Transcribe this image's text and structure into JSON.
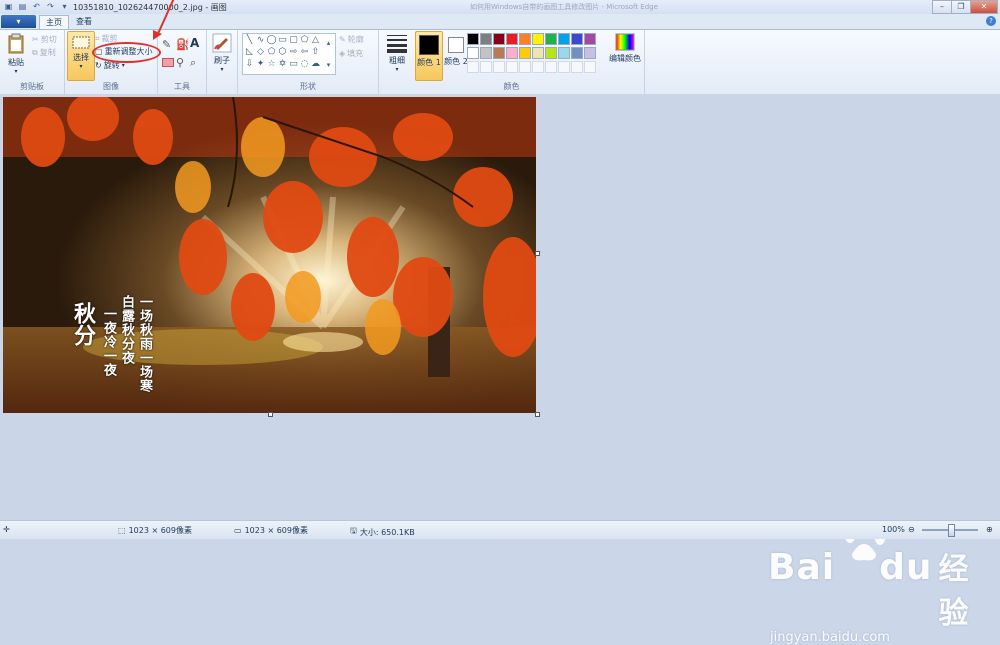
{
  "window": {
    "title": "10351810_102624470000_2.jpg - 画图",
    "faded_title": "如何用Windows自带的画图工具修改图片 - Microsoft Edge"
  },
  "tabs": {
    "app_menu": "▾",
    "home": "主页",
    "view": "查看"
  },
  "clipboard": {
    "paste": "粘贴",
    "cut": "剪切",
    "copy": "复制",
    "label": "剪贴板"
  },
  "image": {
    "select": "选择",
    "crop": "裁剪",
    "resize": "重新调整大小",
    "rotate": "旋转",
    "label": "图像"
  },
  "tools": {
    "label": "工具",
    "text_tool": "A"
  },
  "brushes": {
    "label": "刷子"
  },
  "shapes": {
    "outline": "轮廓",
    "fill": "填充",
    "label": "形状"
  },
  "size": {
    "label": "粗细"
  },
  "colors": {
    "color1": "颜色 1",
    "color2": "颜色 2",
    "edit": "编辑颜色",
    "label": "颜色",
    "palette": [
      "#000000",
      "#7f7f7f",
      "#880015",
      "#ed1c24",
      "#ff7f27",
      "#fff200",
      "#22b14c",
      "#00a2e8",
      "#3f48cc",
      "#a349a4",
      "#ffffff",
      "#c3c3c3",
      "#b97a57",
      "#ffaec9",
      "#ffc90e",
      "#efe4b0",
      "#b5e61d",
      "#99d9ea",
      "#7092be",
      "#c8bfe7"
    ]
  },
  "photo": {
    "title_char": "秋分",
    "line1": "一场秋雨一场寒",
    "line2": "白露秋分夜",
    "line3": "一夜冷一夜"
  },
  "status": {
    "dim1": "1023 × 609像素",
    "dim2": "1023 × 609像素",
    "size": "大小: 650.1KB",
    "zoom": "100%"
  },
  "watermark": {
    "brand": "Bai",
    "brand2": "du",
    "cn": "经验",
    "url": "jingyan.baidu.com"
  }
}
